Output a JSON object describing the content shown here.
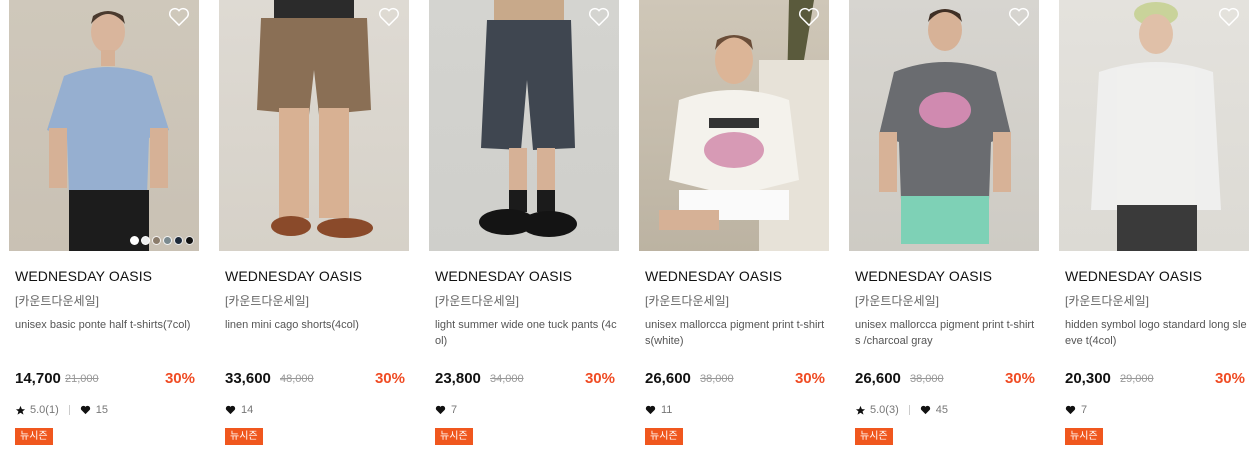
{
  "products": [
    {
      "brand": "WEDNESDAY OASIS",
      "tag": "[카운트다운세일]",
      "name": "unisex basic ponte half t-shirts(7col)",
      "price": "14,700",
      "original_price": "21,000",
      "discount": "30%",
      "rating": "5.0(1)",
      "likes": "15",
      "badge": "뉴시즌",
      "colors": [
        "#ffffff",
        "#eeeeee",
        "#8b7c6b",
        "#7b8a8f",
        "#1e2a3a",
        "#111111"
      ]
    },
    {
      "brand": "WEDNESDAY OASIS",
      "tag": "[카운트다운세일]",
      "name": "linen mini cago shorts(4col)",
      "price": "33,600",
      "original_price": "48,000",
      "discount": "30%",
      "likes": "14",
      "badge": "뉴시즌"
    },
    {
      "brand": "WEDNESDAY OASIS",
      "tag": "[카운트다운세일]",
      "name": "light summer wide one tuck pants (4col)",
      "price": "23,800",
      "original_price": "34,000",
      "discount": "30%",
      "likes": "7",
      "badge": "뉴시즌"
    },
    {
      "brand": "WEDNESDAY OASIS",
      "tag": "[카운트다운세일]",
      "name": "unisex mallorcca pigment print t-shirts(white)",
      "price": "26,600",
      "original_price": "38,000",
      "discount": "30%",
      "likes": "11",
      "badge": "뉴시즌"
    },
    {
      "brand": "WEDNESDAY OASIS",
      "tag": "[카운트다운세일]",
      "name": "unisex mallorcca pigment print t-shirts /charcoal gray",
      "price": "26,600",
      "original_price": "38,000",
      "discount": "30%",
      "rating": "5.0(3)",
      "likes": "45",
      "badge": "뉴시즌"
    },
    {
      "brand": "WEDNESDAY OASIS",
      "tag": "[카운트다운세일]",
      "name": "hidden symbol logo standard long sleeve t(4col)",
      "price": "20,300",
      "original_price": "29,000",
      "discount": "30%",
      "likes": "7",
      "badge": "뉴시즌"
    }
  ],
  "colors": {
    "accent": "#f04c24",
    "badge_bg": "#f0571e"
  }
}
